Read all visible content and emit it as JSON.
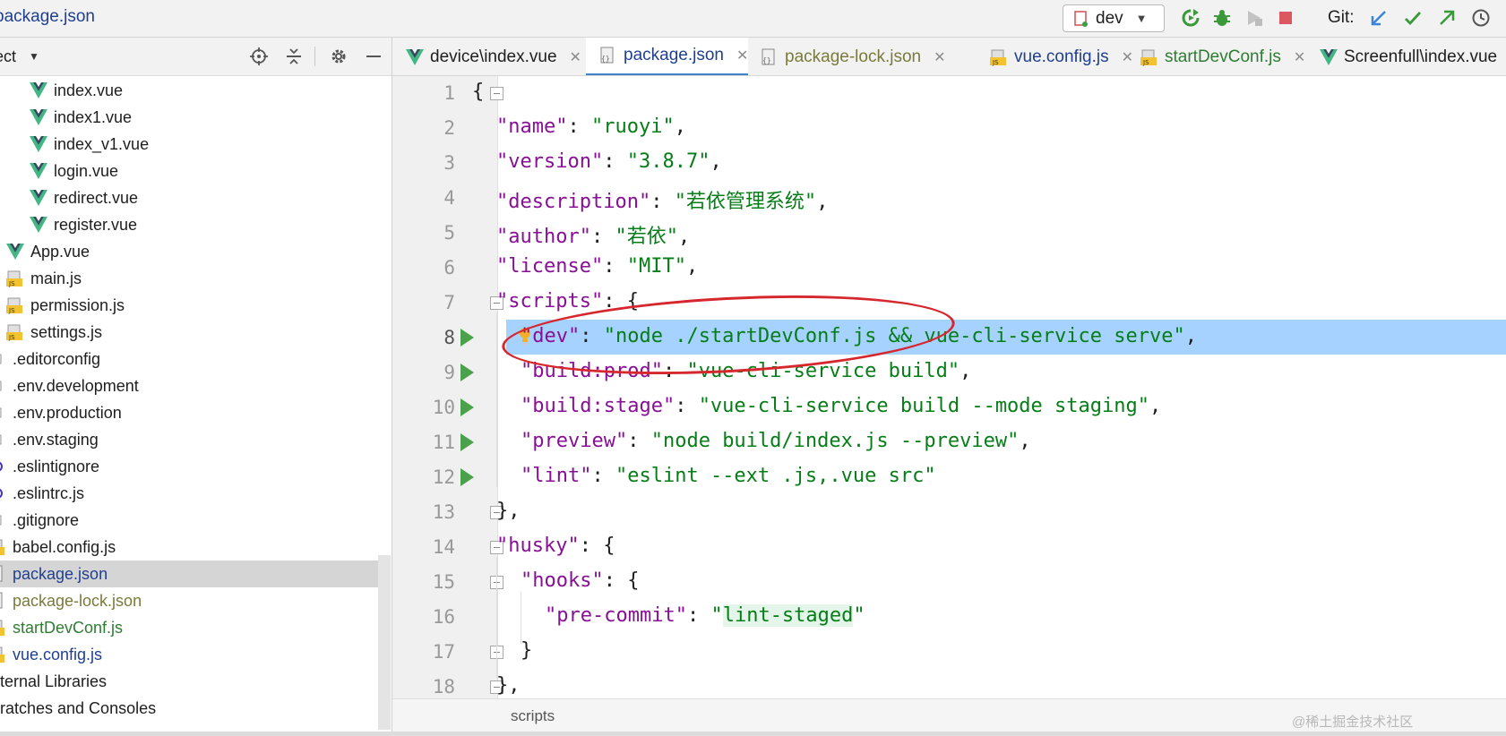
{
  "navbar": {
    "file_name": "package.json",
    "run_config": "dev",
    "git_label": "Git:"
  },
  "project": {
    "title": "ect",
    "tree": [
      {
        "label": "index.vue",
        "icon": "vue-icon",
        "color": "#1e1e1e"
      },
      {
        "label": "index1.vue",
        "icon": "vue-icon",
        "color": "#1e1e1e"
      },
      {
        "label": "index_v1.vue",
        "icon": "vue-icon",
        "color": "#1e1e1e"
      },
      {
        "label": "login.vue",
        "icon": "vue-icon",
        "color": "#1e1e1e"
      },
      {
        "label": "redirect.vue",
        "icon": "vue-icon",
        "color": "#1e1e1e"
      },
      {
        "label": "register.vue",
        "icon": "vue-icon",
        "color": "#1e1e1e"
      },
      {
        "label": "App.vue",
        "icon": "vue-icon",
        "color": "#1e1e1e"
      },
      {
        "label": "main.js",
        "icon": "js-icon",
        "color": "#1e1e1e"
      },
      {
        "label": "permission.js",
        "icon": "js-icon",
        "color": "#1e1e1e"
      },
      {
        "label": "settings.js",
        "icon": "js-icon",
        "color": "#1e1e1e"
      },
      {
        "label": ".editorconfig",
        "icon": "config-icon",
        "color": "#1e1e1e"
      },
      {
        "label": ".env.development",
        "icon": "config-icon",
        "color": "#1e1e1e"
      },
      {
        "label": ".env.production",
        "icon": "config-icon",
        "color": "#1e1e1e"
      },
      {
        "label": ".env.staging",
        "icon": "config-icon",
        "color": "#1e1e1e"
      },
      {
        "label": ".eslintignore",
        "icon": "eslint-icon",
        "color": "#1e1e1e"
      },
      {
        "label": ".eslintrc.js",
        "icon": "eslint-icon",
        "color": "#1e1e1e"
      },
      {
        "label": ".gitignore",
        "icon": "git-icon",
        "color": "#1e1e1e"
      },
      {
        "label": "babel.config.js",
        "icon": "js-icon",
        "color": "#1e1e1e"
      },
      {
        "label": "package.json",
        "icon": "json-icon",
        "color": "#1f3f8f",
        "selected": true
      },
      {
        "label": "package-lock.json",
        "icon": "json-icon",
        "color": "#7a7a3a"
      },
      {
        "label": "startDevConf.js",
        "icon": "js-icon",
        "color": "#2e7d32"
      },
      {
        "label": "vue.config.js",
        "icon": "js-icon",
        "color": "#1f3f8f"
      },
      {
        "label": "ternal Libraries",
        "icon": "library-icon",
        "color": "#1e1e1e"
      },
      {
        "label": "ratches and Consoles",
        "icon": "scratch-icon",
        "color": "#1e1e1e"
      }
    ]
  },
  "tabs": [
    {
      "label": "device\\index.vue",
      "icon": "vue-icon",
      "color": "#1e1e1e",
      "active": false
    },
    {
      "label": "package.json",
      "icon": "json-icon",
      "color": "#1f3f8f",
      "active": true
    },
    {
      "label": "package-lock.json",
      "icon": "json-icon",
      "color": "#7a7a3a",
      "active": false
    },
    {
      "label": "vue.config.js",
      "icon": "js-icon",
      "color": "#1f3f8f",
      "active": false
    },
    {
      "label": "startDevConf.js",
      "icon": "js-icon",
      "color": "#2e7d32",
      "active": false
    },
    {
      "label": "Screenfull\\index.vue",
      "icon": "vue-icon",
      "color": "#1e1e1e",
      "active": false
    }
  ],
  "editor": {
    "lines": [
      {
        "no": "1",
        "tokens": [
          [
            "p",
            "{"
          ]
        ],
        "indent": 0,
        "fold": true
      },
      {
        "no": "2",
        "tokens": [
          [
            "k",
            "\"name\""
          ],
          [
            "p",
            ": "
          ],
          [
            "s",
            "\"ruoyi\""
          ],
          [
            "p",
            ","
          ]
        ],
        "indent": 1
      },
      {
        "no": "3",
        "tokens": [
          [
            "k",
            "\"version\""
          ],
          [
            "p",
            ": "
          ],
          [
            "s",
            "\"3.8.7\""
          ],
          [
            "p",
            ","
          ]
        ],
        "indent": 1
      },
      {
        "no": "4",
        "tokens": [
          [
            "k",
            "\"description\""
          ],
          [
            "p",
            ": "
          ],
          [
            "s",
            "\"若依管理系统\""
          ],
          [
            "p",
            ","
          ]
        ],
        "indent": 1
      },
      {
        "no": "5",
        "tokens": [
          [
            "k",
            "\"author\""
          ],
          [
            "p",
            ": "
          ],
          [
            "s",
            "\"若依\""
          ],
          [
            "p",
            ","
          ]
        ],
        "indent": 1
      },
      {
        "no": "6",
        "tokens": [
          [
            "k",
            "\"license\""
          ],
          [
            "p",
            ": "
          ],
          [
            "s",
            "\"MIT\""
          ],
          [
            "p",
            ","
          ]
        ],
        "indent": 1
      },
      {
        "no": "7",
        "tokens": [
          [
            "k",
            "\"scripts\""
          ],
          [
            "p",
            ": {"
          ]
        ],
        "indent": 1,
        "fold": true
      },
      {
        "no": "8",
        "tokens": [
          [
            "k",
            "\"dev\""
          ],
          [
            "p",
            ": "
          ],
          [
            "s",
            "\"node ./startDevConf.js && vue-cli-service serve\""
          ],
          [
            "p",
            ","
          ]
        ],
        "indent": 2,
        "run": true,
        "highlight": true,
        "bulb": true
      },
      {
        "no": "9",
        "tokens": [
          [
            "k",
            "\"build:prod\""
          ],
          [
            "p",
            ": "
          ],
          [
            "s",
            "\"vue-cli-service build\""
          ],
          [
            "p",
            ","
          ]
        ],
        "indent": 2,
        "run": true
      },
      {
        "no": "10",
        "tokens": [
          [
            "k",
            "\"build:stage\""
          ],
          [
            "p",
            ": "
          ],
          [
            "s",
            "\"vue-cli-service build --mode staging\""
          ],
          [
            "p",
            ","
          ]
        ],
        "indent": 2,
        "run": true
      },
      {
        "no": "11",
        "tokens": [
          [
            "k",
            "\"preview\""
          ],
          [
            "p",
            ": "
          ],
          [
            "s",
            "\"node build/index.js --preview\""
          ],
          [
            "p",
            ","
          ]
        ],
        "indent": 2,
        "run": true
      },
      {
        "no": "12",
        "tokens": [
          [
            "k",
            "\"lint\""
          ],
          [
            "p",
            ": "
          ],
          [
            "s",
            "\"eslint --ext .js,.vue src\""
          ]
        ],
        "indent": 2,
        "run": true
      },
      {
        "no": "13",
        "tokens": [
          [
            "p",
            "},"
          ]
        ],
        "indent": 1,
        "fold": true
      },
      {
        "no": "14",
        "tokens": [
          [
            "k",
            "\"husky\""
          ],
          [
            "p",
            ": {"
          ]
        ],
        "indent": 1,
        "fold": true
      },
      {
        "no": "15",
        "tokens": [
          [
            "k",
            "\"hooks\""
          ],
          [
            "p",
            ": {"
          ]
        ],
        "indent": 2,
        "fold": true
      },
      {
        "no": "16",
        "tokens": [
          [
            "k",
            "\"pre-commit\""
          ],
          [
            "p",
            ": "
          ],
          [
            "s",
            "\""
          ],
          [
            "s-hl",
            "lint-staged"
          ],
          [
            "s",
            "\""
          ]
        ],
        "indent": 3
      },
      {
        "no": "17",
        "tokens": [
          [
            "p",
            "}"
          ]
        ],
        "indent": 2,
        "fold": true
      },
      {
        "no": "18",
        "tokens": [
          [
            "p",
            "},"
          ]
        ],
        "indent": 1,
        "fold": true
      }
    ]
  },
  "breadcrumb": "scripts",
  "watermark": "@稀土掘金技术社区"
}
